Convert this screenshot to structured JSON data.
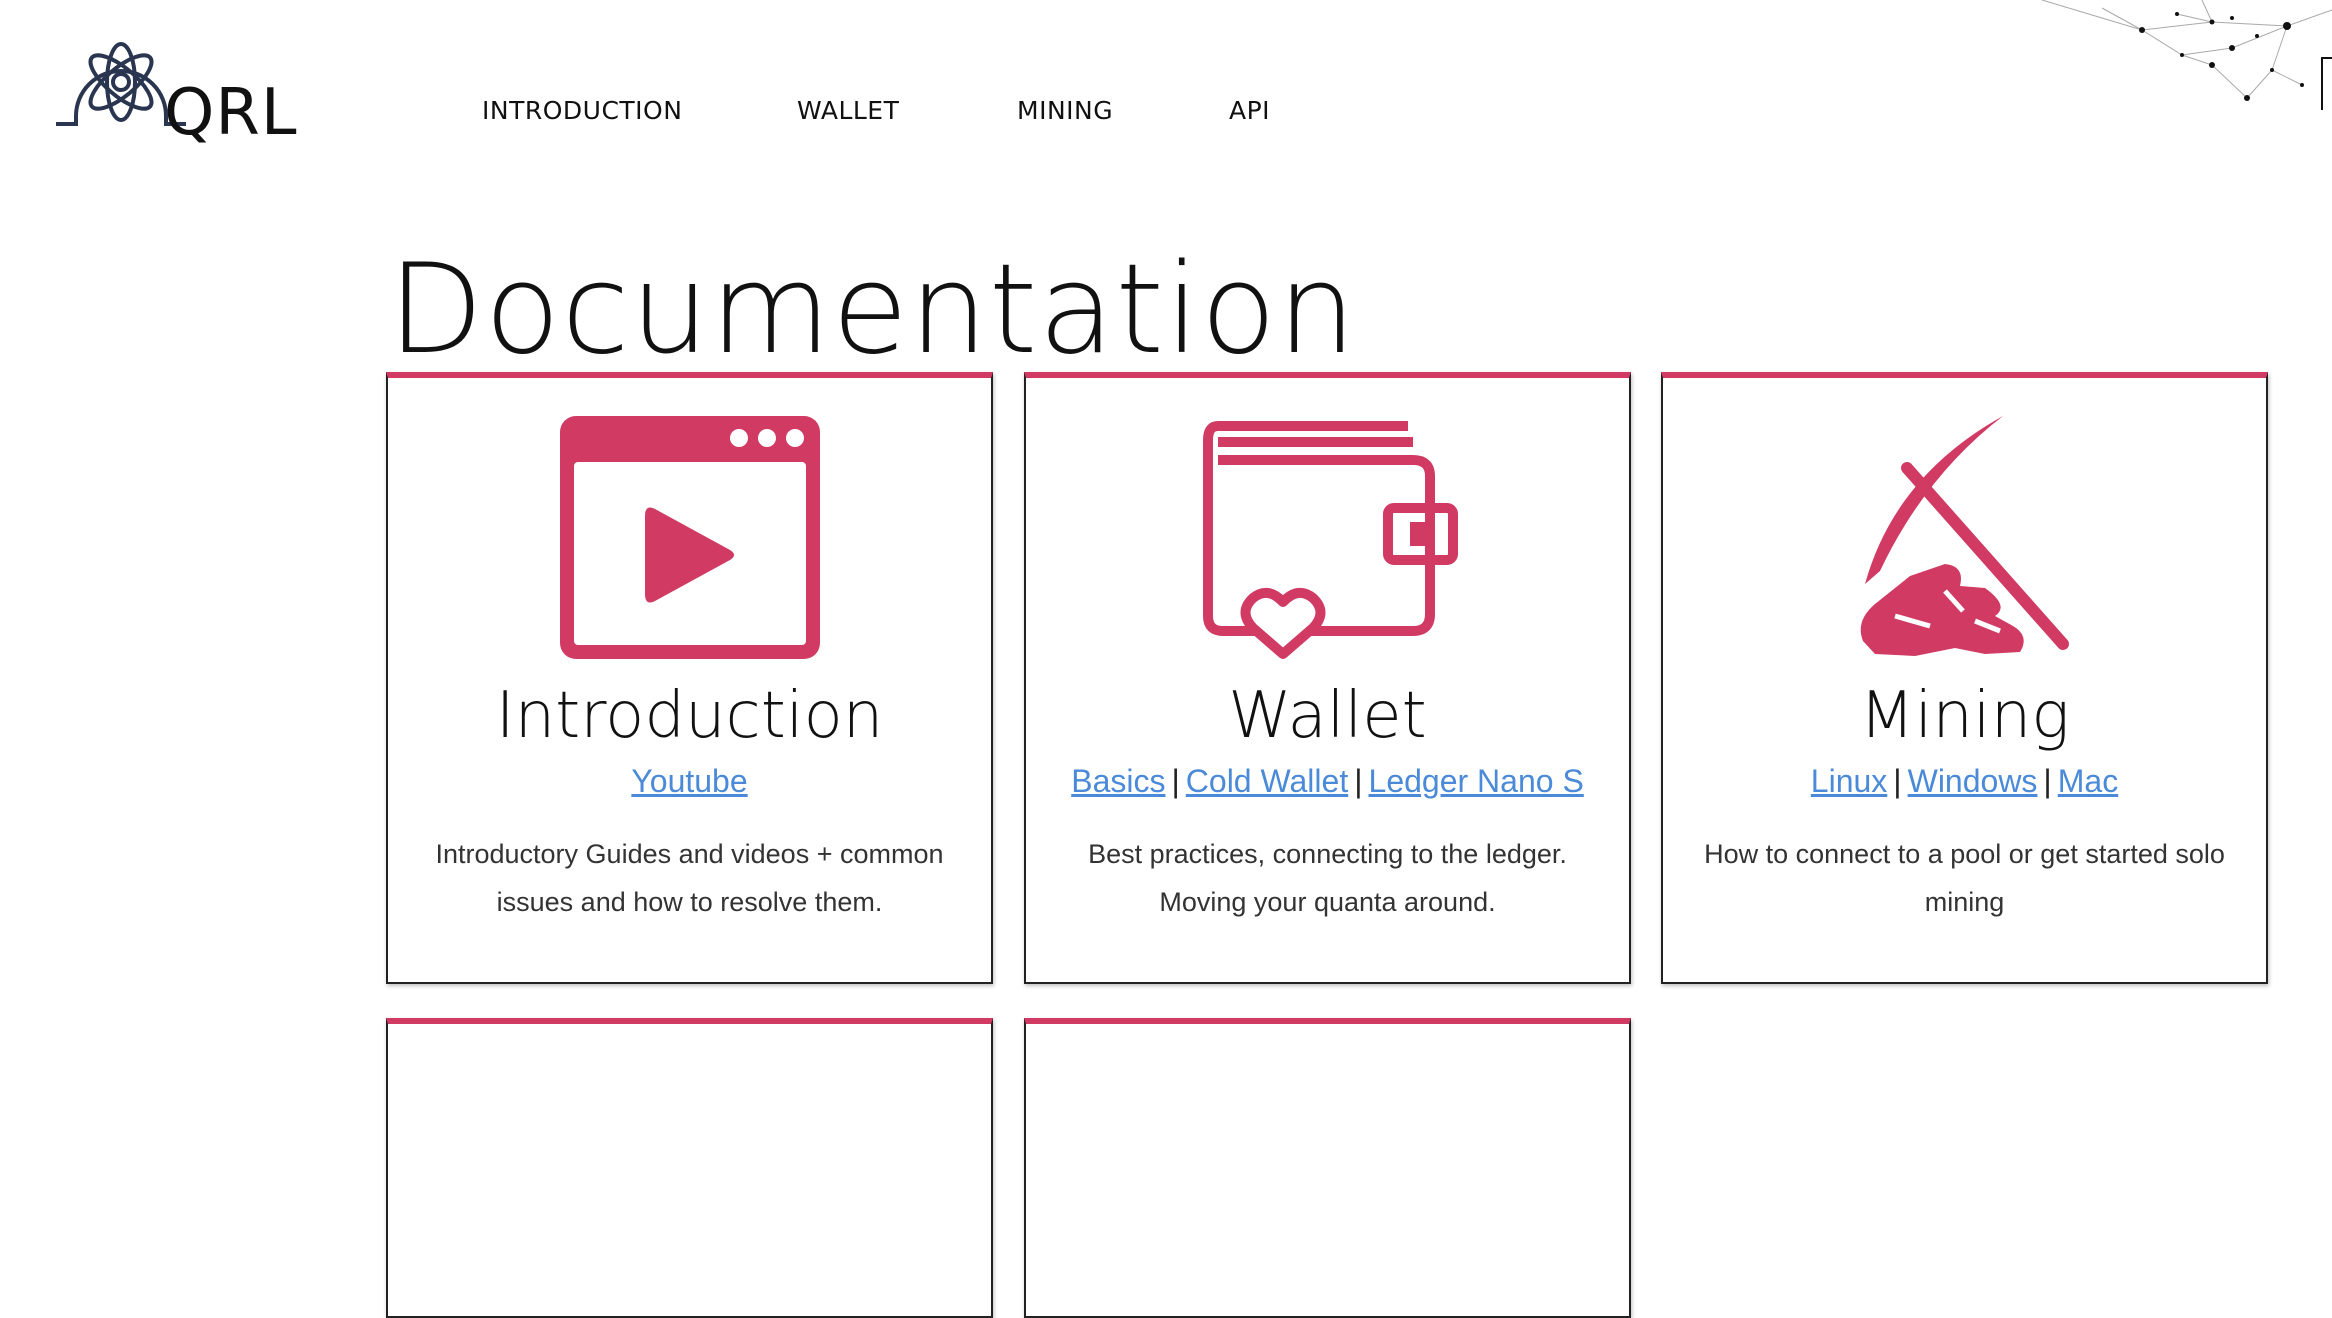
{
  "brand": {
    "name": "QRL"
  },
  "nav": {
    "items": [
      "INTRODUCTION",
      "WALLET",
      "MINING",
      "API"
    ]
  },
  "page": {
    "title": "Documentation"
  },
  "colors": {
    "accent": "#d03a63",
    "link": "#4a8ad8",
    "text": "#111111"
  },
  "cards": [
    {
      "icon": "video-player-icon",
      "title": "Introduction",
      "links": [
        "Youtube"
      ],
      "description": "Introductory Guides and videos + common issues and how to resolve them."
    },
    {
      "icon": "wallet-icon",
      "title": "Wallet",
      "links": [
        "Basics",
        "Cold Wallet",
        "Ledger Nano S"
      ],
      "description": "Best practices, connecting to the ledger. Moving your quanta around."
    },
    {
      "icon": "pickaxe-icon",
      "title": "Mining",
      "links": [
        "Linux",
        "Windows",
        "Mac"
      ],
      "description": "How to connect to a pool or get started solo mining"
    }
  ]
}
